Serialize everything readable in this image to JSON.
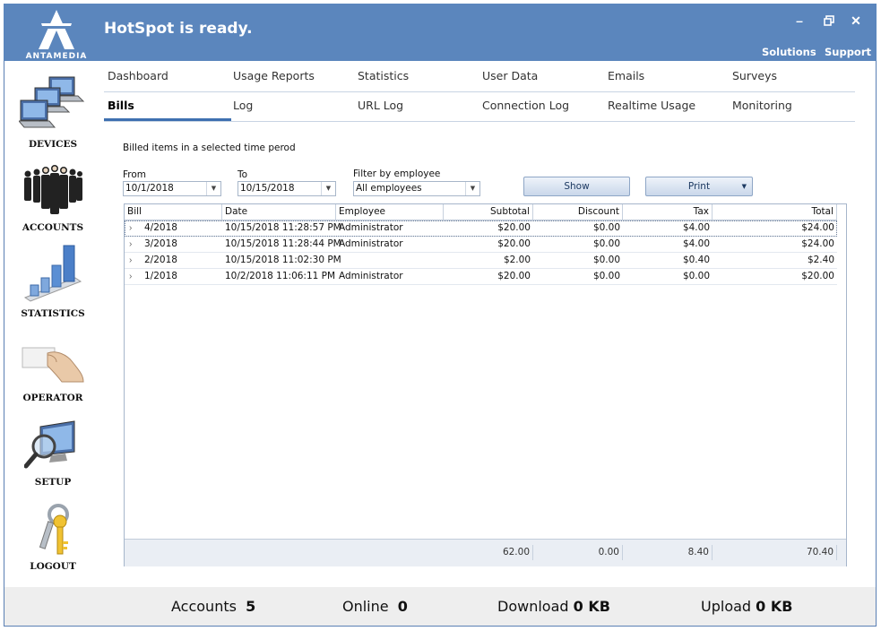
{
  "app": {
    "logo_text": "ANTAMEDIA",
    "status": "HotSpot is ready.",
    "top_links": [
      "Solutions",
      "Support"
    ],
    "window_buttons": [
      "minimize",
      "restore",
      "close"
    ]
  },
  "sidebar": {
    "items": [
      {
        "label": "DEVICES",
        "icon": "devices-icon"
      },
      {
        "label": "ACCOUNTS",
        "icon": "accounts-icon"
      },
      {
        "label": "STATISTICS",
        "icon": "statistics-icon"
      },
      {
        "label": "OPERATOR",
        "icon": "operator-icon"
      },
      {
        "label": "SETUP",
        "icon": "setup-icon"
      },
      {
        "label": "LOGOUT",
        "icon": "logout-icon"
      }
    ]
  },
  "tabs": {
    "row1": [
      "Dashboard",
      "Usage Reports",
      "Statistics",
      "User Data",
      "Emails",
      "Surveys"
    ],
    "row2": [
      "Bills",
      "Log",
      "URL Log",
      "Connection Log",
      "Realtime Usage",
      "Monitoring"
    ],
    "active": "Bills"
  },
  "bills": {
    "subtitle": "Billed items in a selected time perod",
    "from_label": "From",
    "from_value": "10/1/2018",
    "to_label": "To",
    "to_value": "10/15/2018",
    "filter_label": "Filter by employee",
    "filter_value": "All employees",
    "show_label": "Show",
    "print_label": "Print",
    "columns": [
      "Bill",
      "Date",
      "Employee",
      "Subtotal",
      "Discount",
      "Tax",
      "Total"
    ],
    "rows": [
      {
        "bill": "4/2018",
        "date": "10/15/2018 11:28:57 PM",
        "employee": "Administrator",
        "subtotal": "$20.00",
        "discount": "$0.00",
        "tax": "$4.00",
        "total": "$24.00"
      },
      {
        "bill": "3/2018",
        "date": "10/15/2018 11:28:44 PM",
        "employee": "Administrator",
        "subtotal": "$20.00",
        "discount": "$0.00",
        "tax": "$4.00",
        "total": "$24.00"
      },
      {
        "bill": "2/2018",
        "date": "10/15/2018 11:02:30 PM",
        "employee": "",
        "subtotal": "$2.00",
        "discount": "$0.00",
        "tax": "$0.40",
        "total": "$2.40"
      },
      {
        "bill": "1/2018",
        "date": "10/2/2018 11:06:11 PM",
        "employee": "Administrator",
        "subtotal": "$20.00",
        "discount": "$0.00",
        "tax": "$0.00",
        "total": "$20.00"
      }
    ],
    "totals": {
      "subtotal": "62.00",
      "discount": "0.00",
      "tax": "8.40",
      "total": "70.40"
    }
  },
  "statusbar": {
    "accounts_label": "Accounts",
    "accounts_value": "5",
    "online_label": "Online",
    "online_value": "0",
    "download_label": "Download",
    "download_value": "0 KB",
    "upload_label": "Upload",
    "upload_value": "0 KB"
  },
  "colors": {
    "titlebar": "#5b86bd",
    "accent": "#3e70b0"
  }
}
